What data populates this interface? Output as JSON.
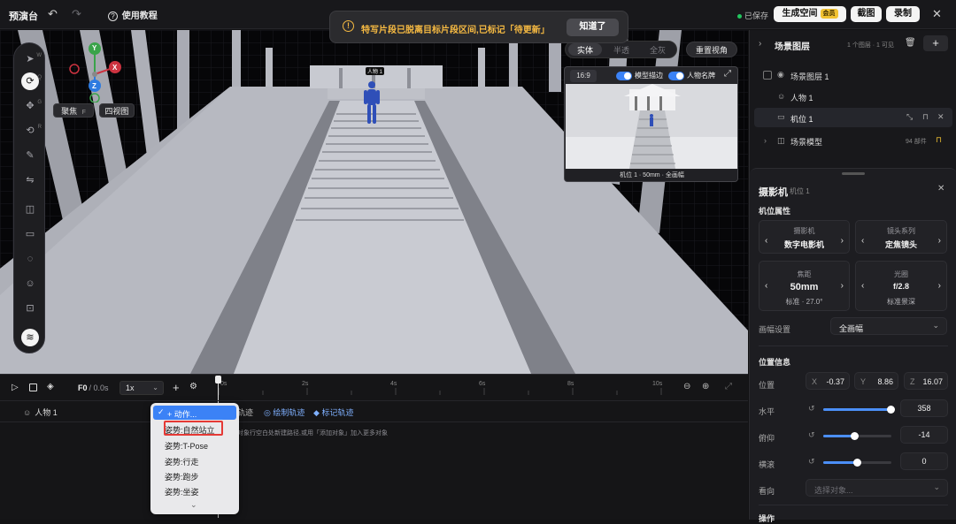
{
  "topbar": {
    "app_title": "预演台",
    "tutorial_label": "使用教程",
    "saved_label": "已保存",
    "generate_label": "生成空间",
    "member_badge": "会员",
    "screenshot_label": "截图",
    "record_label": "录制"
  },
  "toast": {
    "message": "特写片段已脱离目标片段区间,已标记「待更新」",
    "ack_label": "知道了"
  },
  "viewport": {
    "focus_label": "聚焦",
    "focus_key": "F",
    "fourview_label": "四视图",
    "mode_tabs": [
      "实体",
      "半透",
      "全灰"
    ],
    "reset_view_label": "重置视角",
    "character_tag": "人物 1",
    "gizmo_axes": {
      "x": "X",
      "y": "Y",
      "z": "Z"
    },
    "tool_keys": [
      "W",
      "Q",
      "G",
      "R"
    ]
  },
  "pip": {
    "ratio": "16:9",
    "outline_label": "模型描边",
    "nameplate_label": "人物名牌",
    "caption": "机位 1 · 50mm · 全画幅"
  },
  "timeline": {
    "frame_label": "F0",
    "time_label": "/ 0.0s",
    "speed": "1x",
    "ticks": [
      "0s",
      "2s",
      "4s",
      "6s",
      "8s",
      "10s"
    ],
    "track_name": "人物 1",
    "track_actions": [
      "轨迹",
      "绘制轨迹",
      "标记轨迹"
    ],
    "empty_hint": "对象行空白处新建路径,或用「添加对象」加入更多对象"
  },
  "menu": {
    "items": [
      "+ 动作...",
      "姿势:自然站立",
      "姿势:T-Pose",
      "姿势:行走",
      "姿势:跑步",
      "姿势:坐姿"
    ]
  },
  "scene_layers": {
    "title": "场景图层",
    "summary": "1 个图层 · 1 可见",
    "rows": [
      "场景图层 1",
      "人物 1",
      "机位 1",
      "场景模型"
    ],
    "model_count": "94 部件"
  },
  "camera_panel": {
    "title": "摄影机",
    "subtitle": "机位 1",
    "section_props": "机位属性",
    "camera_label": "摄影机",
    "camera_value": "数字电影机",
    "lens_label": "镜头系列",
    "lens_value": "定焦镜头",
    "focal_label": "焦距",
    "focal_value": "50mm",
    "focal_sub": "标准 · 27.0°",
    "aperture_label": "光圈",
    "aperture_value": "f/2.8",
    "aperture_sub": "标准景深",
    "frame_label": "画幅设置",
    "frame_value": "全画幅",
    "section_pos": "位置信息",
    "pos_label": "位置",
    "pos": {
      "x_label": "X",
      "x": "-0.37",
      "y_label": "Y",
      "y": "8.86",
      "z_label": "Z",
      "z": "16.07"
    },
    "pan_label": "水平",
    "pan_value": "358",
    "pan_fraction": 0.99,
    "tilt_label": "俯仰",
    "tilt_value": "-14",
    "tilt_fraction": 0.46,
    "roll_label": "横滚",
    "roll_value": "0",
    "roll_fraction": 0.5,
    "lookat_label": "看向",
    "lookat_placeholder": "选择对象...",
    "bottom_section": "操作"
  },
  "colors": {
    "accent": "#4b8ff7",
    "warning": "#f5b942",
    "highlight_box": "#e53935",
    "gold": "#f1c232"
  }
}
